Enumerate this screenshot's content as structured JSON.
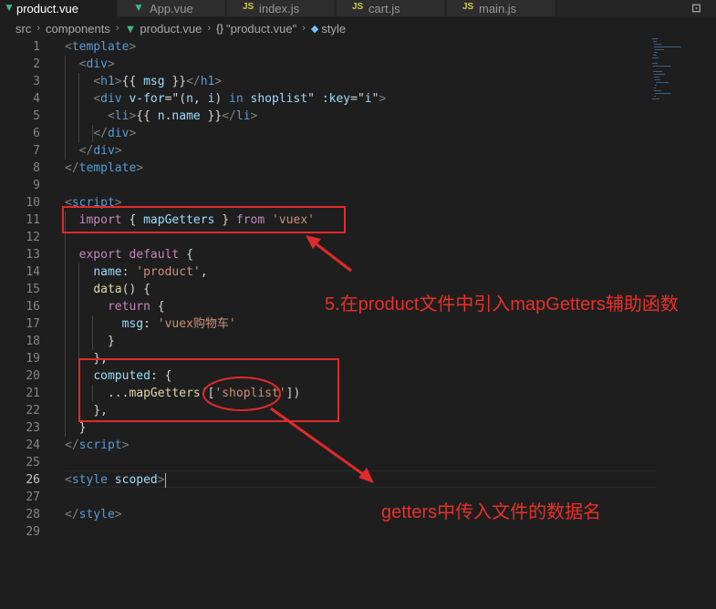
{
  "tabs": [
    {
      "label": "product.vue",
      "icon": "vue-icon",
      "active": true
    },
    {
      "label": "App.vue",
      "icon": "vue-icon",
      "active": false
    },
    {
      "label": "index.js",
      "icon": "js-icon",
      "active": false
    },
    {
      "label": "cart.js",
      "icon": "js-icon",
      "active": false
    },
    {
      "label": "main.js",
      "icon": "js-icon",
      "active": false
    }
  ],
  "tab_actions": {
    "split": "⊡"
  },
  "breadcrumb": {
    "items": [
      "src",
      "components",
      "product.vue",
      "\"product.vue\"",
      "style"
    ]
  },
  "editor": {
    "line_numbers": [
      "1",
      "2",
      "3",
      "4",
      "5",
      "6",
      "7",
      "8",
      "9",
      "10",
      "11",
      "12",
      "13",
      "14",
      "15",
      "16",
      "17",
      "18",
      "19",
      "20",
      "21",
      "22",
      "23",
      "24",
      "25",
      "26",
      "27",
      "28",
      "29"
    ],
    "current_line": "26"
  },
  "annotations": {
    "note_1": "5.在product文件中引入mapGetters辅助函数",
    "note_2": "getters中传入文件的数据名"
  },
  "colors": {
    "annotation_red": "#e12a2a",
    "editor_bg": "#1e1e1e",
    "vue_green": "#41b883",
    "js_yellow": "#cbcb41"
  }
}
